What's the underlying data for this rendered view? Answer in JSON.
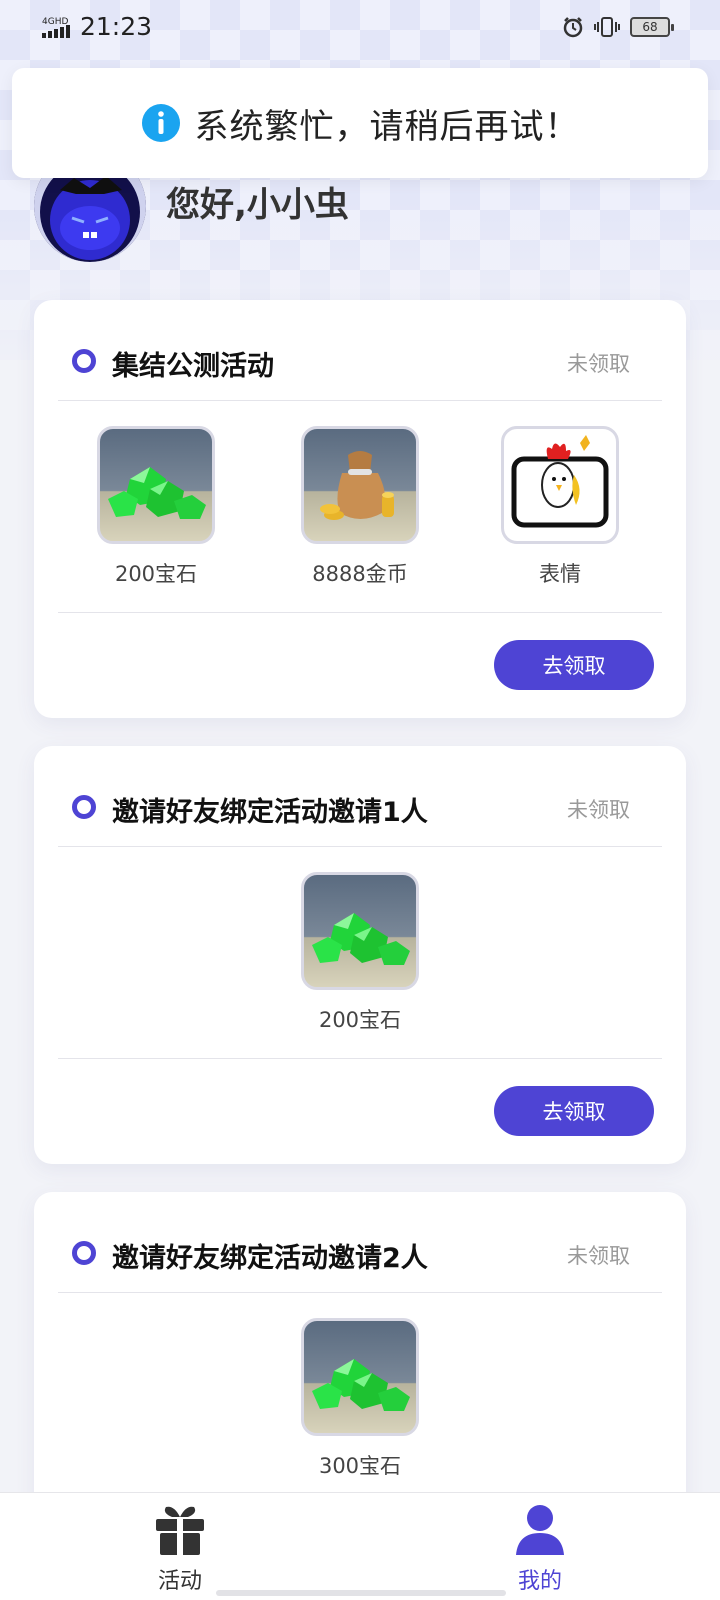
{
  "status_bar": {
    "network": "4GHD",
    "time": "21:23",
    "battery": "68"
  },
  "toast": {
    "message": "系统繁忙，请稍后再试！"
  },
  "profile": {
    "greeting": "您好,小小虫"
  },
  "colors": {
    "accent": "#4e44d4",
    "status_gray": "#999999",
    "toast_info": "#1aa4f0"
  },
  "cards": [
    {
      "title": "集结公测活动",
      "status": "未领取",
      "rewards": [
        {
          "icon": "gems-icon",
          "label": "200宝石"
        },
        {
          "icon": "coin-bag-icon",
          "label": "8888金币"
        },
        {
          "icon": "chicken-emoji-icon",
          "label": "表情"
        }
      ],
      "button": "去领取"
    },
    {
      "title": "邀请好友绑定活动邀请1人",
      "status": "未领取",
      "rewards": [
        {
          "icon": "gems-icon",
          "label": "200宝石"
        }
      ],
      "button": "去领取"
    },
    {
      "title": "邀请好友绑定活动邀请2人",
      "status": "未领取",
      "rewards": [
        {
          "icon": "gems-icon",
          "label": "300宝石"
        }
      ]
    }
  ],
  "nav": [
    {
      "icon": "gift-icon",
      "label": "活动",
      "active": false
    },
    {
      "icon": "person-icon",
      "label": "我的",
      "active": true
    }
  ]
}
